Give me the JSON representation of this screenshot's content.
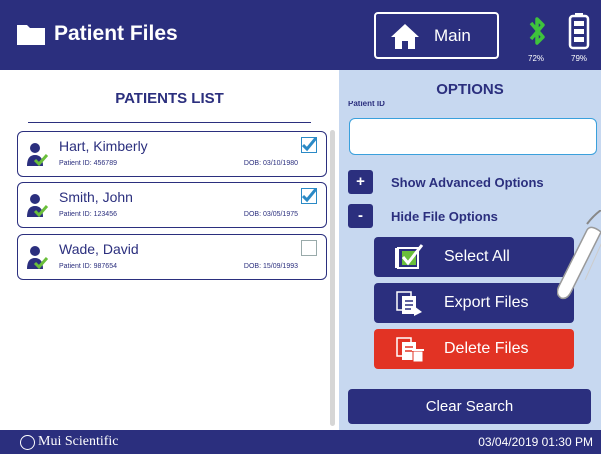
{
  "header": {
    "title": "Patient Files",
    "main_button": "Main",
    "bluetooth_pct": "72%",
    "battery_pct": "79%"
  },
  "patients_list": {
    "title": "PATIENTS LIST",
    "patients": [
      {
        "name": "Hart, Kimberly",
        "id_label": "Patient ID: 456789",
        "dob_label": "DOB: 03/10/1980",
        "selected": true
      },
      {
        "name": "Smith, John",
        "id_label": "Patient ID: 123456",
        "dob_label": "DOB: 03/05/1975",
        "selected": true
      },
      {
        "name": "Wade, David",
        "id_label": "Patient ID: 987654",
        "dob_label": "DOB: 15/09/1993",
        "selected": false
      }
    ]
  },
  "options": {
    "title": "OPTIONS",
    "patient_id_label": "Patient ID",
    "patient_id_value": "",
    "show_advanced": {
      "symbol": "+",
      "label": "Show Advanced Options"
    },
    "hide_file": {
      "symbol": "-",
      "label": "Hide File Options"
    },
    "select_all": "Select All",
    "export_files": "Export Files",
    "delete_files": "Delete Files",
    "clear_search": "Clear Search"
  },
  "footer": {
    "brand": "Mui Scientific",
    "datetime": "03/04/2019 01:30 PM"
  },
  "colors": {
    "navy": "#2b2f7e",
    "panel": "#c7d8f0",
    "delete_red": "#e23324",
    "check_green": "#6abf3b",
    "bluetooth_green": "#3ec33c"
  }
}
